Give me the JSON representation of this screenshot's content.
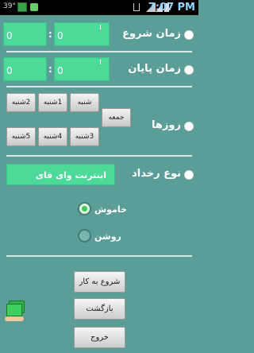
{
  "status_bar": {
    "temperature": "39°",
    "time": "7:07 PM"
  },
  "start_time": {
    "label": "زمان شروع",
    "hour": "0",
    "minute": "0",
    "separator": ":"
  },
  "end_time": {
    "label": "زمان پایان",
    "hour": "0",
    "minute": "0",
    "separator": ":"
  },
  "days": {
    "label": "روزها",
    "buttons": {
      "shanbe": "شنبه",
      "yekshanbe": "1شنبه",
      "doshanbe": "2شنبه",
      "jome": "جمعه",
      "seshanbe": "3شنبه",
      "chaharshanbe": "4شنبه",
      "panjshanbe": "5شنبه"
    }
  },
  "event_type": {
    "label": "نوع رخداد",
    "value": "اینترنت وای فای"
  },
  "state_options": {
    "off_label": "خاموش",
    "on_label": "روشن",
    "selected": "off"
  },
  "actions": {
    "start": "شروع به کار",
    "back": "بازگشت",
    "exit": "خروج"
  },
  "colors": {
    "background": "#5b9e98",
    "field": "#4cd99a",
    "accent_selected": "#3fc955"
  }
}
